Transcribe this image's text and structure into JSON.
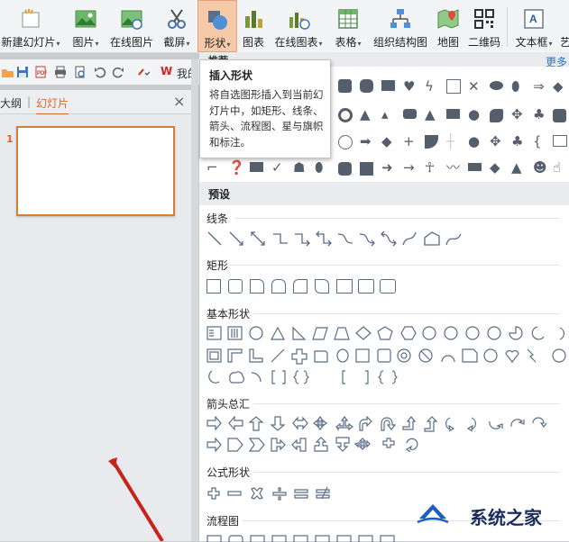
{
  "ribbon": {
    "items": [
      {
        "label": "新建幻灯片",
        "dd": true
      },
      {
        "label": "图片",
        "dd": true
      },
      {
        "label": "在线图片",
        "dd": false
      },
      {
        "label": "截屏",
        "dd": true
      },
      {
        "label": "形状",
        "dd": true
      },
      {
        "label": "图表",
        "dd": false
      },
      {
        "label": "在线图表",
        "dd": true
      },
      {
        "label": "表格",
        "dd": true
      },
      {
        "label": "组织结构图",
        "dd": false
      },
      {
        "label": "地图",
        "dd": false
      },
      {
        "label": "二维码",
        "dd": false
      },
      {
        "label": "文本框",
        "dd": true
      },
      {
        "label": "艺",
        "dd": false
      }
    ],
    "dropdown_glyph": "▾"
  },
  "quick_toolbar": {
    "brand_logo": "W",
    "brand_text": "我的"
  },
  "left_panel": {
    "tab_outline": "大纲",
    "tab_slides": "幻灯片",
    "close_glyph": "×",
    "slide_number": "1"
  },
  "shape_panel": {
    "header": "推荐",
    "more": "更多",
    "preset": "预设",
    "categories": [
      "线条",
      "矩形",
      "基本形状",
      "箭头总汇",
      "公式形状",
      "流程图"
    ]
  },
  "tooltip": {
    "title": "插入形状",
    "description": "将自选图形插入到当前幻灯片中，如矩形、线条、箭头、流程图、星与旗帜和标注。"
  },
  "watermark": {
    "text": "系统之家"
  },
  "colors": {
    "accent": "#d86a2b",
    "shape_stroke": "#5a6d86",
    "active_button": "#f6c9a9",
    "link": "#2f74c9"
  }
}
